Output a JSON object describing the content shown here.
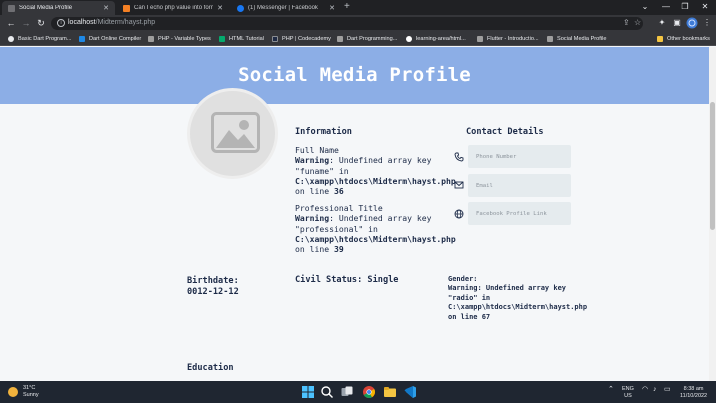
{
  "browser": {
    "tabs": [
      {
        "title": "Social Media Profile",
        "active": true,
        "color": "#6f6f73"
      },
      {
        "title": "Can I echo php value into form?",
        "active": false,
        "color": "#f48024"
      },
      {
        "title": "(1) Messenger | Facebook",
        "active": false,
        "color": "#1877f2"
      }
    ],
    "new_tab": "+",
    "url_host": "localhost",
    "url_path": "/Midterm/hayst.php",
    "bookmarks": [
      {
        "label": "Basic Dart Program...",
        "color": "#e8eaed"
      },
      {
        "label": "Dart Online Compiler",
        "color": "#1e88e5"
      },
      {
        "label": "PHP - Variable Types",
        "color": "#9e9e9e"
      },
      {
        "label": "HTML Tutorial",
        "color": "#04aa6d"
      },
      {
        "label": "PHP | Codecademy",
        "color": "#1f2a44"
      },
      {
        "label": "Dart Programming...",
        "color": "#9e9e9e"
      },
      {
        "label": "learning-area/html...",
        "color": "#ffffff"
      },
      {
        "label": "Flutter - Introductio...",
        "color": "#9e9e9e"
      },
      {
        "label": "Social Media Profile",
        "color": "#9e9e9e"
      },
      {
        "label": "Other bookmarks",
        "color": "#f4c542"
      }
    ]
  },
  "page": {
    "title": "Social Media Profile",
    "banner_color": "#8caee6",
    "information": {
      "heading": "Information",
      "full_name_label": "Full Name",
      "full_name_warning": {
        "prefix": "Warning",
        "message": ": Undefined array key \"funame\" in",
        "file": "C:\\xampp\\htdocs\\Midterm\\hayst.php",
        "line_text": "on line",
        "line": "36"
      },
      "professional_label": "Professional Title",
      "professional_warning": {
        "prefix": "Warning",
        "message": ": Undefined array key \"professional\" in",
        "file": "C:\\xampp\\htdocs\\Midterm\\hayst.php",
        "line_text": "on line",
        "line": "39"
      }
    },
    "contact": {
      "heading": "Contact Details",
      "phone_placeholder": "Phone Number",
      "email_placeholder": "Email",
      "facebook_placeholder": "Facebook Profile Link"
    },
    "birthdate_label": "Birthdate:",
    "birthdate_value": "0012-12-12",
    "civil_status": "Civil Status: Single",
    "gender": {
      "label": "Gender:",
      "warning": "Warning: Undefined array key \"radio\" in",
      "file": "C:\\xampp\\htdocs\\Midterm\\hayst.php",
      "line_text": "on line 67"
    },
    "education_heading": "Education"
  },
  "taskbar": {
    "temperature": "31°C",
    "condition": "Sunny",
    "language": "ENG",
    "region": "US",
    "time": "8:38 am",
    "date": "11/10/2022"
  }
}
